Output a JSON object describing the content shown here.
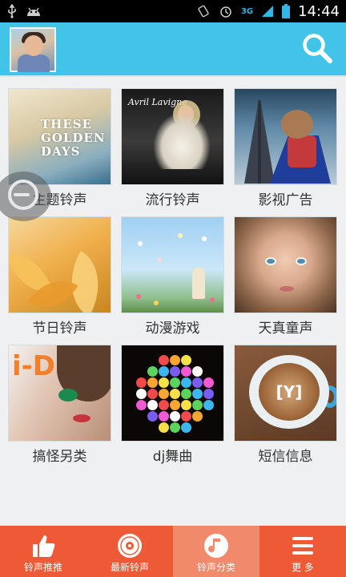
{
  "status_bar": {
    "network_label": "3G",
    "time": "14:44"
  },
  "header": {
    "avatar_name": "avatar",
    "search_icon": "search-icon"
  },
  "categories": [
    {
      "label": "主题铃声",
      "thumb_text": "THESE GOLDEN DAYS"
    },
    {
      "label": "流行铃声",
      "thumb_text": "Avril Lavigne"
    },
    {
      "label": "影视广告",
      "thumb_text": ""
    },
    {
      "label": "节日铃声",
      "thumb_text": ""
    },
    {
      "label": "动漫游戏",
      "thumb_text": ""
    },
    {
      "label": "天真童声",
      "thumb_text": ""
    },
    {
      "label": "搞怪另类",
      "thumb_text": "i-D"
    },
    {
      "label": "dj舞曲",
      "thumb_text": ""
    },
    {
      "label": "短信信息",
      "thumb_text": "[Y]"
    }
  ],
  "bottom_nav": {
    "items": [
      {
        "label": "铃声推推",
        "icon": "thumbs-up-icon",
        "active": false
      },
      {
        "label": "最新铃声",
        "icon": "record-icon",
        "active": false
      },
      {
        "label": "铃声分类",
        "icon": "music-note-icon",
        "active": true
      },
      {
        "label": "更  多",
        "icon": "menu-icon",
        "active": false
      }
    ]
  },
  "colors": {
    "header": "#41c4e8",
    "bottom_nav": "#ef5a36",
    "bottom_nav_active": "#f18a6a",
    "background": "#eef0f1"
  }
}
